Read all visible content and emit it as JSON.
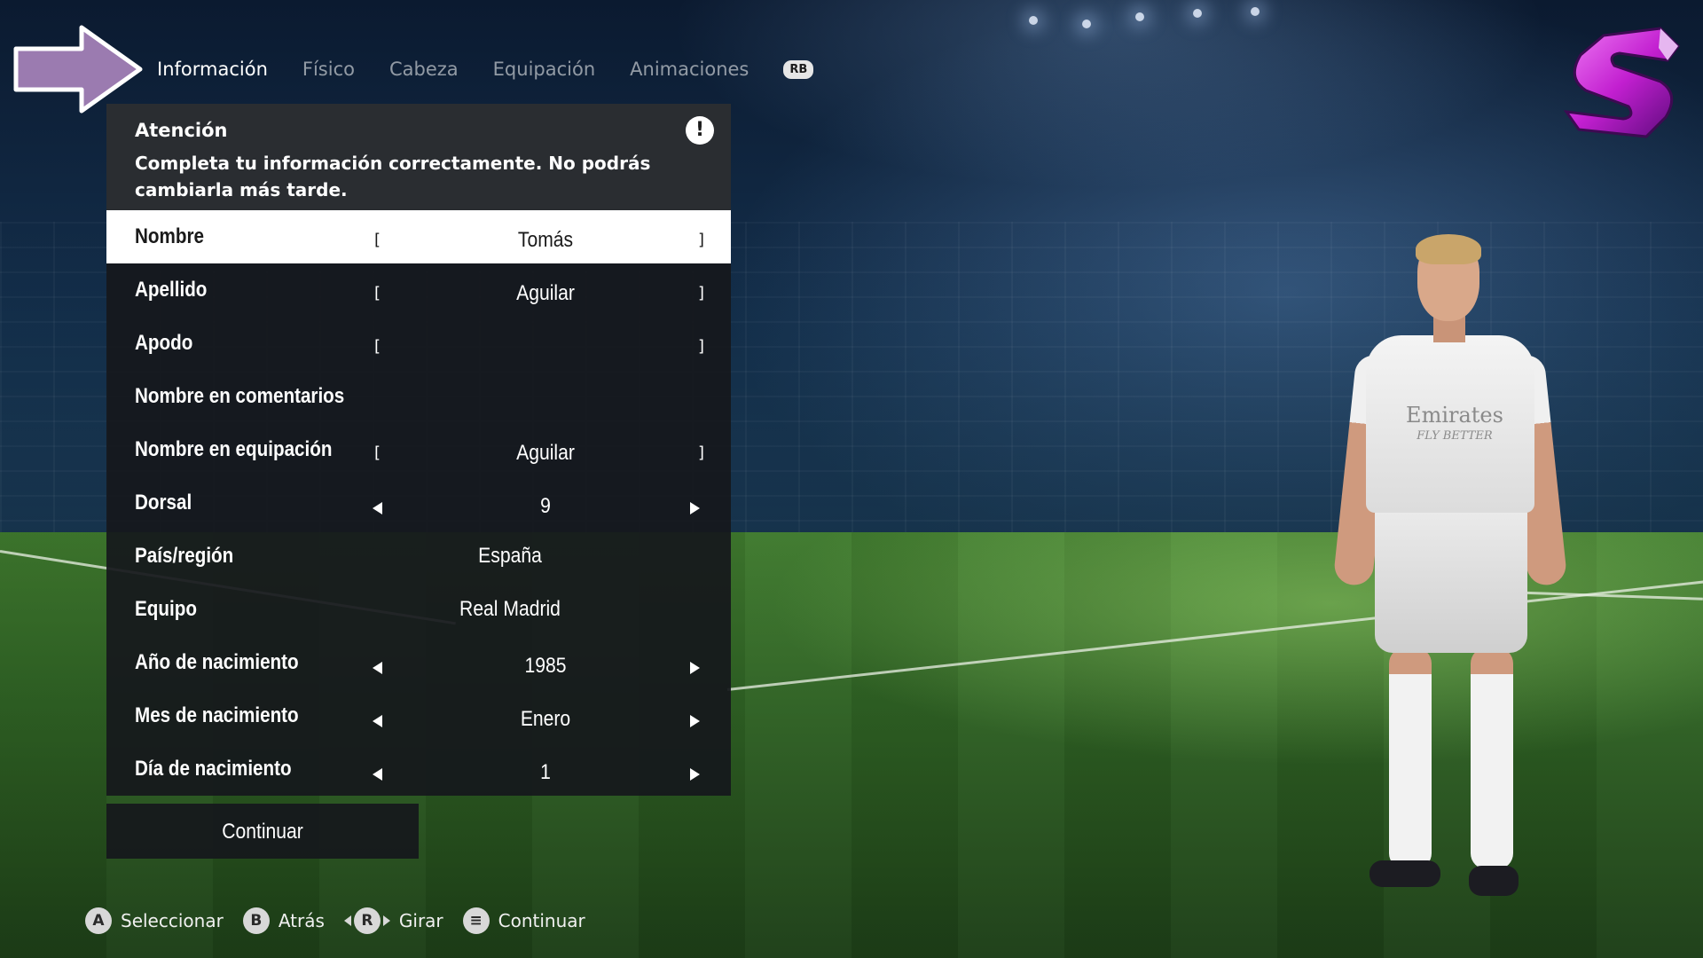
{
  "tabs": [
    {
      "label": "Información",
      "active": true
    },
    {
      "label": "Físico",
      "active": false
    },
    {
      "label": "Cabeza",
      "active": false
    },
    {
      "label": "Equipación",
      "active": false
    },
    {
      "label": "Animaciones",
      "active": false
    }
  ],
  "rb_badge": "RB",
  "warning": {
    "title": "Atención",
    "text": "Completa tu información correctamente. No podrás cambiarla más tarde.",
    "icon": "!"
  },
  "form": {
    "nombre": {
      "label": "Nombre",
      "value": "Tomás"
    },
    "apellido": {
      "label": "Apellido",
      "value": "Aguilar"
    },
    "apodo": {
      "label": "Apodo",
      "value": ""
    },
    "comentarios": {
      "label": "Nombre en comentarios"
    },
    "equipacion": {
      "label": "Nombre en equipación",
      "value": "Aguilar"
    },
    "dorsal": {
      "label": "Dorsal",
      "value": "9"
    },
    "pais": {
      "label": "País/región",
      "value": "España"
    },
    "equipo": {
      "label": "Equipo",
      "value": "Real Madrid"
    },
    "anio": {
      "label": "Año de nacimiento",
      "value": "1985"
    },
    "mes": {
      "label": "Mes de nacimiento",
      "value": "Enero"
    },
    "dia": {
      "label": "Día de nacimiento",
      "value": "1"
    }
  },
  "bracket_open": "[",
  "bracket_close": "]",
  "continue_label": "Continuar",
  "hints": [
    {
      "button": "A",
      "label": "Seleccionar"
    },
    {
      "button": "B",
      "label": "Atrás"
    },
    {
      "button": "R",
      "label": "Girar"
    },
    {
      "button": "≡",
      "label": "Continuar"
    }
  ],
  "player_shirt": {
    "sponsor": "Emirates",
    "tagline": "FLY BETTER"
  },
  "colors": {
    "accent_arrow": "#9b7bb0",
    "logo_magenta": "#d63bd8",
    "selected_row": "#ffffff",
    "panel": "#16181c"
  }
}
